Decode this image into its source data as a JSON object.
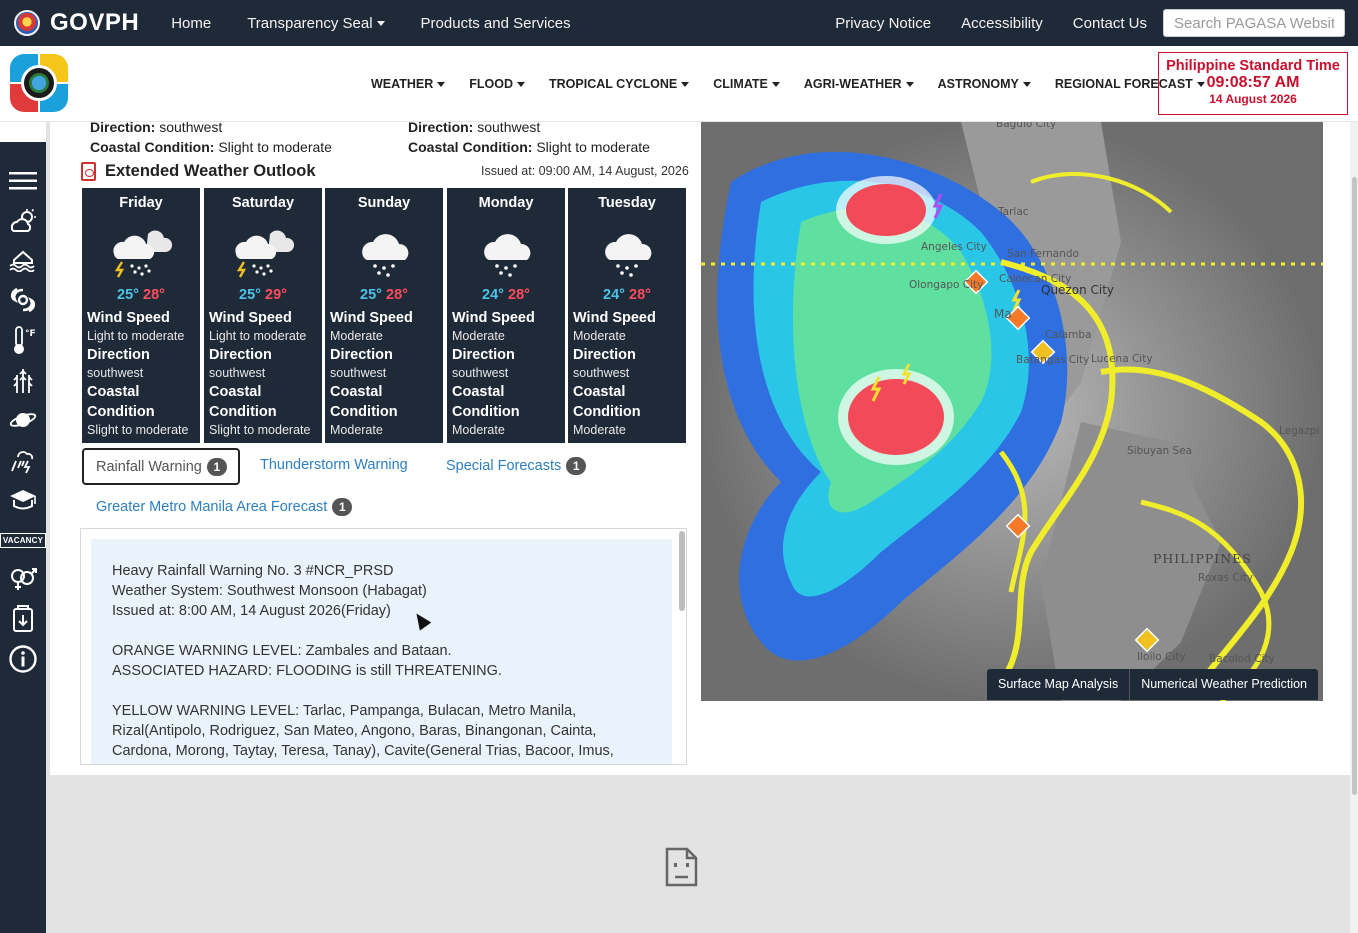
{
  "govbar": {
    "brand": "GOVPH",
    "nav": [
      "Home",
      "Transparency Seal",
      "Products and Services"
    ],
    "nav_has_dropdown": [
      false,
      true,
      false
    ],
    "right_links": [
      "Privacy Notice",
      "Accessibility",
      "Contact Us"
    ],
    "search_placeholder": "Search PAGASA Website"
  },
  "header": {
    "nav": [
      "WEATHER",
      "FLOOD",
      "TROPICAL CYCLONE",
      "CLIMATE",
      "AGRI-WEATHER",
      "ASTRONOMY",
      "REGIONAL FORECAST"
    ],
    "pst": {
      "label": "Philippine Standard Time",
      "time": "09:08:57 AM",
      "date": "14 August 2026"
    }
  },
  "sidebar": {
    "icons": [
      "menu-icon",
      "weather-icon",
      "flood-icon",
      "tropical-cyclone-icon",
      "climate-icon",
      "agri-weather-icon",
      "astronomy-icon",
      "thunderstorm-icon",
      "education-icon",
      "vacancy-icon",
      "gender-icon",
      "pdf-icon-book",
      "info-icon"
    ],
    "vacancy_text": "VACANCY"
  },
  "prev": {
    "left": {
      "dir_label": "Direction:",
      "dir_value": "southwest",
      "coastal_label": "Coastal Condition:",
      "coastal_value": "Slight to moderate"
    },
    "right": {
      "dir_label": "Direction:",
      "dir_value": "southwest",
      "coastal_label": "Coastal Condition:",
      "coastal_value": "Slight to moderate"
    }
  },
  "outlook": {
    "title": "Extended Weather Outlook",
    "issued": "Issued at: 09:00 AM, 14 August, 2026",
    "labels": {
      "wind": "Wind Speed",
      "direction": "Direction",
      "coastal1": "Coastal",
      "coastal2": "Condition"
    },
    "days": [
      {
        "day": "Friday",
        "icon": "thunderstorm-rain-icon",
        "low": "25°",
        "high": "28°",
        "wind": "Light to moderate",
        "direction": "southwest",
        "coastal": "Slight to moderate"
      },
      {
        "day": "Saturday",
        "icon": "thunderstorm-rain-icon",
        "low": "25°",
        "high": "29°",
        "wind": "Light to moderate",
        "direction": "southwest",
        "coastal": "Slight to moderate"
      },
      {
        "day": "Sunday",
        "icon": "rain-cloud-icon",
        "low": "25°",
        "high": "28°",
        "wind": "Moderate",
        "direction": "southwest",
        "coastal": "Moderate"
      },
      {
        "day": "Monday",
        "icon": "rain-cloud-icon",
        "low": "24°",
        "high": "28°",
        "wind": "Moderate",
        "direction": "southwest",
        "coastal": "Moderate"
      },
      {
        "day": "Tuesday",
        "icon": "rain-cloud-icon",
        "low": "24°",
        "high": "28°",
        "wind": "Moderate",
        "direction": "southwest",
        "coastal": "Moderate"
      }
    ]
  },
  "tabs": [
    {
      "label": "Rainfall Warning",
      "badge": "1",
      "active": true
    },
    {
      "label": "Thunderstorm Warning",
      "badge": "",
      "active": false
    },
    {
      "label": "Special Forecasts",
      "badge": "1",
      "active": false
    },
    {
      "label": "Greater Metro Manila Area Forecast",
      "badge": "1",
      "active": false
    }
  ],
  "warning": {
    "lines1": [
      "Heavy Rainfall Warning No. 3 #NCR_PRSD",
      "Weather System: Southwest Monsoon (Habagat)",
      "Issued at: 8:00 AM, 14 August 2026(Friday)"
    ],
    "lines2": [
      "ORANGE WARNING LEVEL: Zambales and Bataan.",
      "ASSOCIATED HAZARD: FLOODING is still THREATENING."
    ],
    "lines3": [
      "YELLOW WARNING LEVEL: Tarlac, Pampanga, Bulacan, Metro Manila,",
      "Rizal(Antipolo, Rodriguez, San Mateo, Angono, Baras, Binangonan, Cainta,",
      "Cardona, Morong, Taytay, Teresa, Tanay), Cavite(General Trias, Bacoor, Imus,"
    ]
  },
  "map": {
    "places": [
      "Baguio City",
      "Tarlac",
      "Angeles City",
      "San Fernando",
      "Olongapo City",
      "Caloocan City",
      "Quezon City",
      "Manila",
      "Calamba",
      "Batangas City",
      "Lucena City",
      "Sibuyan Sea",
      "PHILIPPINES",
      "Roxas City",
      "Iloilo City",
      "Bacolod City",
      "Legazpi",
      "Ma"
    ],
    "buttons": [
      "Surface Map Analysis",
      "Numerical Weather Prediction"
    ]
  },
  "colors": {
    "navy": "#1f2a38",
    "pst_red": "#c8102e",
    "link_blue": "#2d7fc1",
    "temp_low": "#4cc3e8",
    "temp_high": "#ff4d5e"
  }
}
